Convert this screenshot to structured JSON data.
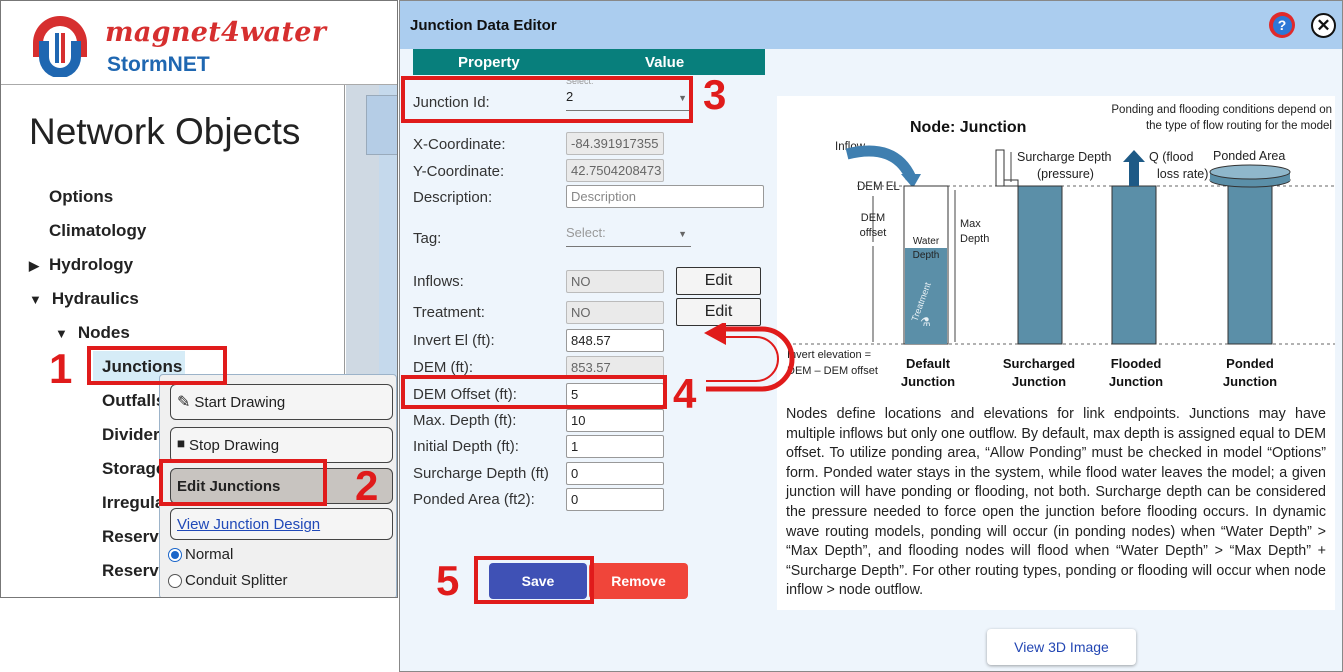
{
  "app": {
    "brand": "magnet4water",
    "product": "StormNET"
  },
  "nav": {
    "title": "Network Objects",
    "items": [
      "Options",
      "Climatology",
      "Hydrology",
      "Hydraulics",
      "Nodes",
      "Junctions",
      "Outfalls",
      "Divider",
      "Storage",
      "Irregula",
      "Reserv",
      "Reserv"
    ]
  },
  "context_menu": {
    "start_drawing": "Start Drawing",
    "stop_drawing": "Stop Drawing",
    "edit_junctions": "Edit Junctions",
    "view_design": "View Junction Design",
    "radio_normal": "Normal",
    "radio_splitter": "Conduit Splitter",
    "selected_mode": "Normal"
  },
  "editor": {
    "title": "Junction Data Editor",
    "col_property": "Property",
    "col_value": "Value",
    "select_caption": "Select:",
    "fields": {
      "junction_id": {
        "label": "Junction Id:",
        "value": "2"
      },
      "x_coord": {
        "label": "X-Coordinate:",
        "value": "-84.391917355"
      },
      "y_coord": {
        "label": "Y-Coordinate:",
        "value": "42.7504208473"
      },
      "description": {
        "label": "Description:",
        "placeholder": "Description"
      },
      "tag": {
        "label": "Tag:",
        "placeholder": "Select:"
      },
      "inflows": {
        "label": "Inflows:",
        "value": "NO"
      },
      "treatment": {
        "label": "Treatment:",
        "value": "NO"
      },
      "invert_el": {
        "label": "Invert El (ft):",
        "value": "848.57"
      },
      "dem": {
        "label": "DEM (ft):",
        "value": "853.57"
      },
      "dem_offset": {
        "label": "DEM Offset (ft):",
        "value": "5"
      },
      "max_depth": {
        "label": "Max. Depth (ft):",
        "value": "10"
      },
      "initial_depth": {
        "label": "Initial Depth (ft):",
        "value": "1"
      },
      "surcharge_depth": {
        "label": "Surcharge Depth (ft)",
        "value": "0"
      },
      "ponded_area": {
        "label": "Ponded Area (ft2):",
        "value": "0"
      }
    },
    "edit_label": "Edit",
    "save_label": "Save",
    "remove_label": "Remove",
    "view3d_label": "View 3D Image",
    "description_text": "Nodes define locations and elevations for link endpoints.  Junctions may have multiple inflows but only one outflow.  By default, max depth is assigned equal to DEM offset. To utilize ponding area, “Allow Ponding” must be checked in model “Options” form. Ponded water stays in the system, while flood water leaves the model; a given junction will have ponding or flooding, not both. Surcharge depth can be considered the pressure needed to force open the junction before flooding occurs. In dynamic wave routing models, ponding will occur (in ponding nodes) when “Water Depth” > “Max Depth”, and flooding nodes will flood when “Water Depth” > “Max Depth” + “Surcharge Depth”.  For other routing types, ponding or flooding will occur when node inflow > node outflow."
  },
  "diagram": {
    "note_line1": "Ponding and flooding conditions depend on",
    "note_line2": "the type of flow routing for the model",
    "title": "Node: Junction",
    "inflow": "Inflow",
    "dem_el": "DEM EL",
    "dem_offset_1": "DEM",
    "dem_offset_2": "offset",
    "max_1": "Max",
    "max_2": "Depth",
    "water_1": "Water",
    "water_2": "Depth",
    "treatment": "Treatment",
    "surcharge_1": "Surcharge Depth",
    "surcharge_2": "(pressure)",
    "q_1": "Q (flood",
    "q_2": "loss rate)",
    "ponded_area": "Ponded Area",
    "invert_1": "Invert elevation =",
    "invert_2": "DEM – DEM offset",
    "labels": [
      [
        "Default",
        "Junction"
      ],
      [
        "Surcharged",
        "Junction"
      ],
      [
        "Flooded",
        "Junction"
      ],
      [
        "Ponded",
        "Junction"
      ]
    ]
  },
  "annotations": {
    "s1": "1",
    "s2": "2",
    "s3": "3",
    "s4": "4",
    "s5": "5"
  },
  "colors": {
    "header": "#abcdef",
    "grid_header": "#087f7c",
    "save": "#3f51b5",
    "remove": "#f0453a",
    "annotation": "#e01b1b"
  }
}
